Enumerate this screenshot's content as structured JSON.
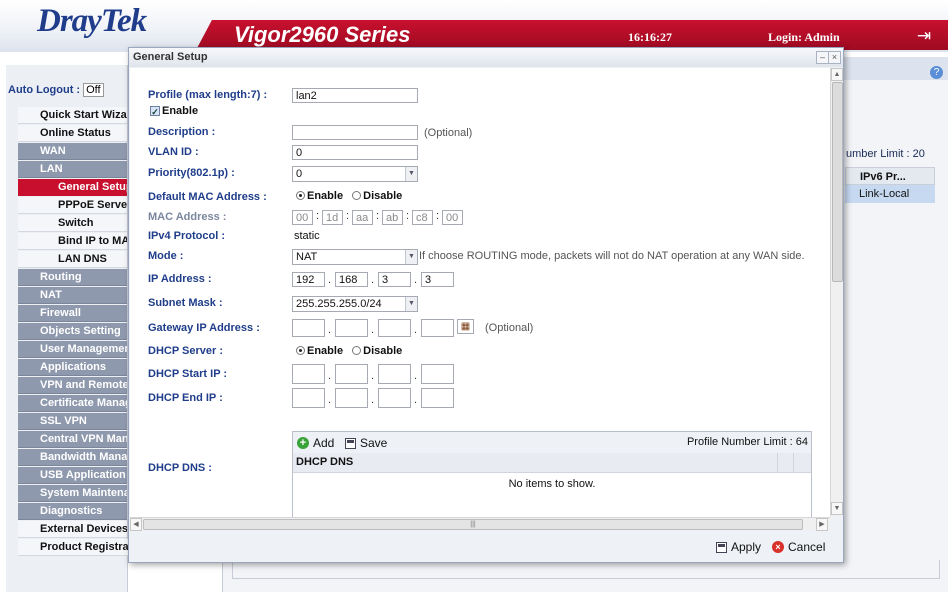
{
  "header": {
    "brand_part1": "Dray",
    "brand_part2": "Tek",
    "model": "Vigor2960 Series",
    "clock": "16:16:27",
    "login": "Login: Admin"
  },
  "menu": {
    "auto_logout_label": "Auto Logout :",
    "auto_logout_value": "Off",
    "items": [
      {
        "label": "Quick Start Wizard"
      },
      {
        "label": "Online Status"
      },
      {
        "label": "WAN"
      },
      {
        "label": "LAN"
      },
      {
        "label": "General Setup"
      },
      {
        "label": "PPPoE Server"
      },
      {
        "label": "Switch"
      },
      {
        "label": "Bind IP to MAC"
      },
      {
        "label": "LAN DNS"
      },
      {
        "label": "Routing"
      },
      {
        "label": "NAT"
      },
      {
        "label": "Firewall"
      },
      {
        "label": "Objects Setting"
      },
      {
        "label": "User Management"
      },
      {
        "label": "Applications"
      },
      {
        "label": "VPN and Remote Access"
      },
      {
        "label": "Certificate Management"
      },
      {
        "label": "SSL VPN"
      },
      {
        "label": "Central VPN Management"
      },
      {
        "label": "Bandwidth Management"
      },
      {
        "label": "USB Application"
      },
      {
        "label": "System Maintenance"
      },
      {
        "label": "Diagnostics"
      },
      {
        "label": "External Devices"
      },
      {
        "label": "Product Registration"
      }
    ]
  },
  "background": {
    "limit_text": "umber Limit : 20",
    "col_header": "IPv6 Pr...",
    "row_value": "Link-Local"
  },
  "dialog": {
    "title": "General Setup",
    "profile_label": "Profile (max length:7) :",
    "profile_value": "lan2",
    "enable_label": "Enable",
    "description_label": "Description :",
    "description_value": "",
    "optional_hint": "(Optional)",
    "vlan_label": "VLAN ID :",
    "vlan_value": "0",
    "priority_label": "Priority(802.1p) :",
    "priority_value": "0",
    "default_mac_label": "Default MAC Address :",
    "radio_enable": "Enable",
    "radio_disable": "Disable",
    "mac_label": "MAC Address :",
    "mac_octets": [
      "00",
      "1d",
      "aa",
      "ab",
      "c8",
      "00"
    ],
    "ipv4_label": "IPv4 Protocol :",
    "ipv4_value": "static",
    "mode_label": "Mode :",
    "mode_value": "NAT",
    "mode_hint": "If choose ROUTING mode, packets will not do NAT operation at any WAN side.",
    "ip_label": "IP Address :",
    "ip_octets": [
      "192",
      "168",
      "3",
      "3"
    ],
    "subnet_label": "Subnet Mask :",
    "subnet_value": "255.255.255.0/24",
    "gateway_label": "Gateway IP Address :",
    "gateway_hint": "(Optional)",
    "dhcp_server_label": "DHCP Server :",
    "dhcp_start_label": "DHCP Start IP :",
    "dhcp_end_label": "DHCP End IP :",
    "dhcp_dns_label": "DHCP DNS :",
    "dns_add": "Add",
    "dns_save": "Save",
    "dns_limit": "Profile Number Limit : 64",
    "dns_header": "DHCP DNS",
    "dns_empty": "No items to show.",
    "apply": "Apply",
    "cancel": "Cancel"
  }
}
